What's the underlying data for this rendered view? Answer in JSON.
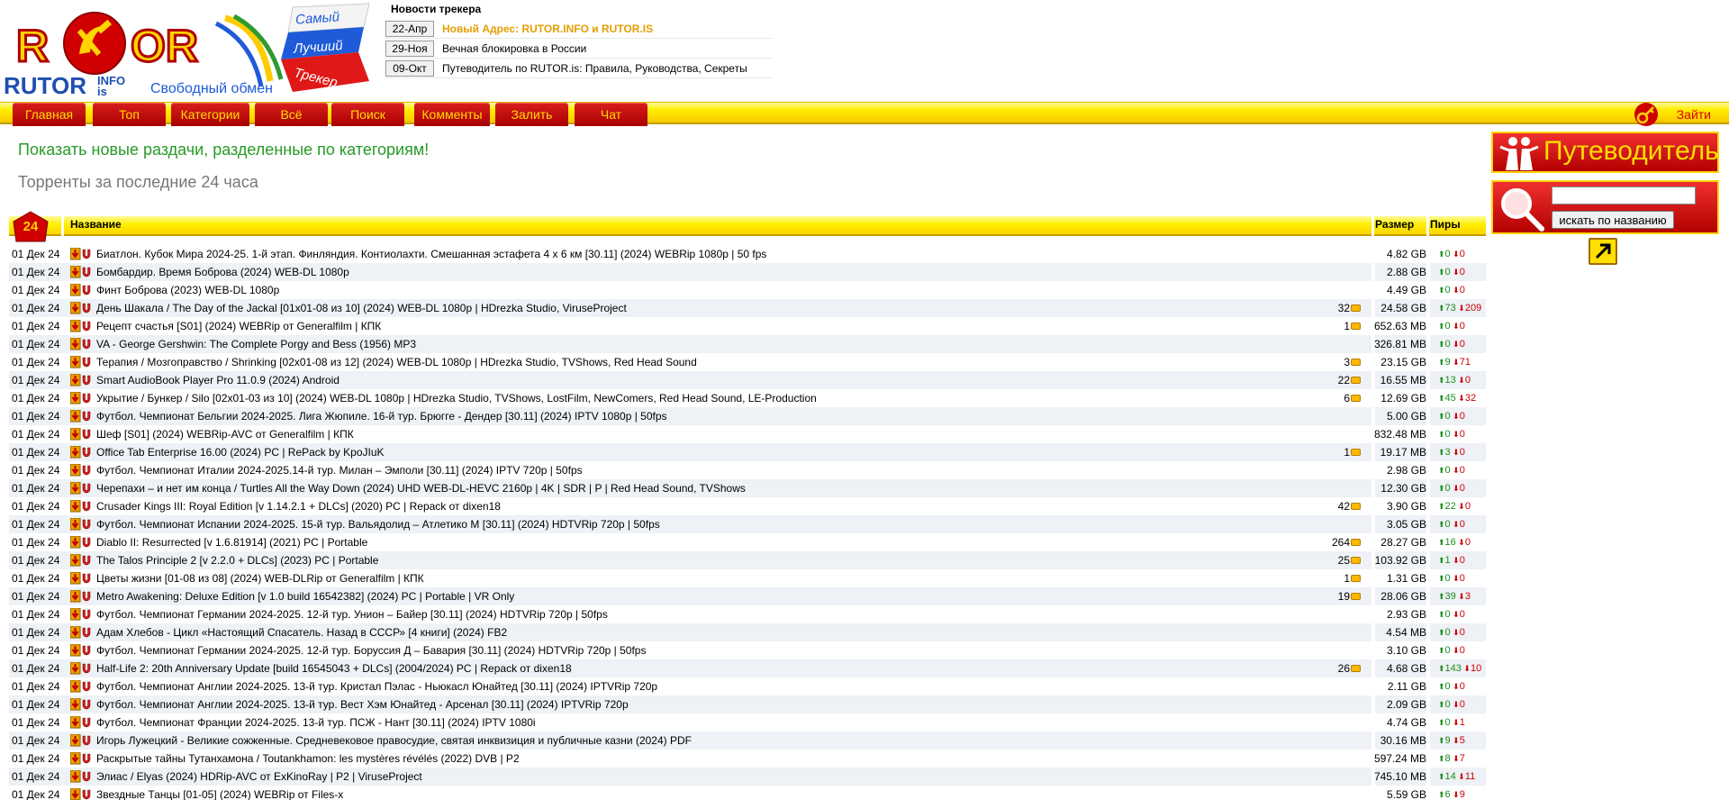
{
  "logo": {
    "tagline_1": "Самый",
    "tagline_2": "Лучший",
    "tagline_3": "Трекер",
    "brand": "RUTOR",
    "brand_info": "INFO",
    "brand_is": "is",
    "slogan": "Свободный обмен"
  },
  "news": {
    "title": "Новости трекера",
    "items": [
      {
        "date": "22-Апр",
        "text": "Новый Адрес: RUTOR.INFO и RUTOR.IS",
        "highlight": true
      },
      {
        "date": "29-Ноя",
        "text": "Вечная блокировка в России",
        "highlight": false
      },
      {
        "date": "09-Окт",
        "text": "Путеводитель по RUTOR.is: Правила, Руководства, Секреты",
        "highlight": false
      }
    ]
  },
  "menu": {
    "items": [
      "Главная",
      "Топ",
      "Категории",
      "Всё",
      "Поиск",
      "Комменты",
      "Залить",
      "Чат"
    ],
    "login": "Зайти"
  },
  "main": {
    "heading": "Показать новые раздачи, разделенные по категориям!",
    "subheading": "Торренты за последние 24 часа",
    "badge": "24",
    "columns": {
      "name": "Название",
      "size": "Размер",
      "peers": "Пиры"
    }
  },
  "torrents": [
    {
      "date": "01 Дек 24",
      "name": "Биатлон. Кубок Мира 2024-25. 1-й этап. Финляндия. Контиолахти. Смешанная эстафета 4 x 6 км [30.11] (2024) WEBRip 1080p | 50 fps",
      "comments": "",
      "size": "4.82 GB",
      "seeds": "0",
      "leech": "0"
    },
    {
      "date": "01 Дек 24",
      "name": "Бомбардир. Время Боброва (2024) WEB-DL 1080p",
      "comments": "",
      "size": "2.88 GB",
      "seeds": "0",
      "leech": "0"
    },
    {
      "date": "01 Дек 24",
      "name": "Финт Боброва (2023) WEB-DL 1080p",
      "comments": "",
      "size": "4.49 GB",
      "seeds": "0",
      "leech": "0"
    },
    {
      "date": "01 Дек 24",
      "name": "День Шакала / The Day of the Jackal [01x01-08 из 10] (2024) WEB-DL 1080p | HDrezka Studio, ViruseProject",
      "comments": "32",
      "size": "24.58 GB",
      "seeds": "73",
      "leech": "209"
    },
    {
      "date": "01 Дек 24",
      "name": "Рецепт счастья [S01] (2024) WEBRip от Generalfilm | КПК",
      "comments": "1",
      "size": "652.63 MB",
      "seeds": "0",
      "leech": "0"
    },
    {
      "date": "01 Дек 24",
      "name": "VA - George Gershwin: The Complete Porgy and Bess (1956) MP3",
      "comments": "",
      "size": "326.81 MB",
      "seeds": "0",
      "leech": "0"
    },
    {
      "date": "01 Дек 24",
      "name": "Терапия / Мозгоправство / Shrinking [02x01-08 из 12] (2024) WEB-DL 1080p | HDrezka Studio, TVShows, Red Head Sound",
      "comments": "3",
      "size": "23.15 GB",
      "seeds": "9",
      "leech": "71"
    },
    {
      "date": "01 Дек 24",
      "name": "Smart AudioBook Player Pro 11.0.9 (2024) Android",
      "comments": "22",
      "size": "16.55 MB",
      "seeds": "13",
      "leech": "0"
    },
    {
      "date": "01 Дек 24",
      "name": "Укрытие / Бункер / Silo [02x01-03 из 10] (2024) WEB-DL 1080p | HDrezka Studio, TVShows, LostFilm, NewComers, Red Head Sound, LE-Production",
      "comments": "6",
      "size": "12.69 GB",
      "seeds": "45",
      "leech": "32"
    },
    {
      "date": "01 Дек 24",
      "name": "Футбол. Чемпионат Бельгии 2024-2025. Лига Жюпиле. 16-й тур. Брюгге - Дендер [30.11] (2024) IPTV 1080p | 50fps",
      "comments": "",
      "size": "5.00 GB",
      "seeds": "0",
      "leech": "0"
    },
    {
      "date": "01 Дек 24",
      "name": "Шеф [S01] (2024) WEBRip-AVC от Generalfilm | КПК",
      "comments": "",
      "size": "832.48 MB",
      "seeds": "0",
      "leech": "0"
    },
    {
      "date": "01 Дек 24",
      "name": "Office Tab Enterprise 16.00 (2024) PC | RePack by KpoJIuK",
      "comments": "1",
      "size": "19.17 MB",
      "seeds": "3",
      "leech": "0"
    },
    {
      "date": "01 Дек 24",
      "name": "Футбол. Чемпионат Италии 2024-2025.14-й тур. Милан – Эмполи [30.11] (2024) IPTV 720p | 50fps",
      "comments": "",
      "size": "2.98 GB",
      "seeds": "0",
      "leech": "0"
    },
    {
      "date": "01 Дек 24",
      "name": "Черепахи – и нет им конца / Turtles All the Way Down (2024) UHD WEB-DL-HEVC 2160p | 4K | SDR | P | Red Head Sound, TVShows",
      "comments": "",
      "size": "12.30 GB",
      "seeds": "0",
      "leech": "0"
    },
    {
      "date": "01 Дек 24",
      "name": "Crusader Kings III: Royal Edition [v 1.14.2.1 + DLCs] (2020) PC | Repack от dixen18",
      "comments": "42",
      "size": "3.90 GB",
      "seeds": "22",
      "leech": "0"
    },
    {
      "date": "01 Дек 24",
      "name": "Футбол. Чемпионат Испании 2024-2025. 15-й тур. Вальядолид – Атлетико М [30.11] (2024) HDTVRip 720p | 50fps",
      "comments": "",
      "size": "3.05 GB",
      "seeds": "0",
      "leech": "0"
    },
    {
      "date": "01 Дек 24",
      "name": "Diablo II: Resurrected [v 1.6.81914] (2021) PC | Portable",
      "comments": "264",
      "size": "28.27 GB",
      "seeds": "16",
      "leech": "0"
    },
    {
      "date": "01 Дек 24",
      "name": "The Talos Principle 2 [v 2.2.0 + DLCs] (2023) PC | Portable",
      "comments": "25",
      "size": "103.92 GB",
      "seeds": "1",
      "leech": "0"
    },
    {
      "date": "01 Дек 24",
      "name": "Цветы жизни [01-08 из 08] (2024) WEB-DLRip от Generalfilm | КПК",
      "comments": "1",
      "size": "1.31 GB",
      "seeds": "0",
      "leech": "0"
    },
    {
      "date": "01 Дек 24",
      "name": "Metro Awakening: Deluxe Edition [v 1.0 build 16542382] (2024) PC | Portable | VR Only",
      "comments": "19",
      "size": "28.06 GB",
      "seeds": "39",
      "leech": "3"
    },
    {
      "date": "01 Дек 24",
      "name": "Футбол. Чемпионат Германии 2024-2025. 12-й тур. Унион – Байер [30.11] (2024) HDTVRip 720p | 50fps",
      "comments": "",
      "size": "2.93 GB",
      "seeds": "0",
      "leech": "0"
    },
    {
      "date": "01 Дек 24",
      "name": "Адам Хлебов - Цикл «Настоящий Спасатель. Назад в СССР» [4 книги] (2024) FB2",
      "comments": "",
      "size": "4.54 MB",
      "seeds": "0",
      "leech": "0"
    },
    {
      "date": "01 Дек 24",
      "name": "Футбол. Чемпионат Германии 2024-2025. 12-й тур. Боруссия Д – Бавария [30.11] (2024) HDTVRip 720p | 50fps",
      "comments": "",
      "size": "3.10 GB",
      "seeds": "0",
      "leech": "0"
    },
    {
      "date": "01 Дек 24",
      "name": "Half-Life 2: 20th Anniversary Update [build 16545043 + DLCs] (2004/2024) PC | Repack от dixen18",
      "comments": "26",
      "size": "4.68 GB",
      "seeds": "143",
      "leech": "10"
    },
    {
      "date": "01 Дек 24",
      "name": "Футбол. Чемпионат Англии 2024-2025. 13-й тур. Кристал Пэлас - Ньюкасл Юнайтед [30.11] (2024) IPTVRip 720p",
      "comments": "",
      "size": "2.11 GB",
      "seeds": "0",
      "leech": "0"
    },
    {
      "date": "01 Дек 24",
      "name": "Футбол. Чемпионат Англии 2024-2025. 13-й тур. Вест Хэм Юнайтед - Арсенал [30.11] (2024) IPTVRip 720p",
      "comments": "",
      "size": "2.09 GB",
      "seeds": "0",
      "leech": "0"
    },
    {
      "date": "01 Дек 24",
      "name": "Футбол. Чемпионат Франции 2024-2025. 13-й тур. ПСЖ - Нант [30.11] (2024) IPTV 1080i",
      "comments": "",
      "size": "4.74 GB",
      "seeds": "0",
      "leech": "1"
    },
    {
      "date": "01 Дек 24",
      "name": "Игорь Лужецкий - Великие сожженные. Средневековое правосудие, святая инквизиция и публичные казни (2024) PDF",
      "comments": "",
      "size": "30.16 MB",
      "seeds": "9",
      "leech": "5"
    },
    {
      "date": "01 Дек 24",
      "name": "Раскрытые тайны Тутанхамона / Toutankhamon: les mystères révélés (2022) DVB | P2",
      "comments": "",
      "size": "597.24 MB",
      "seeds": "8",
      "leech": "7"
    },
    {
      "date": "01 Дек 24",
      "name": "Элиас / Elyas (2024) HDRip-AVC от ExKinoRay | P2 | ViruseProject",
      "comments": "",
      "size": "745.10 MB",
      "seeds": "14",
      "leech": "11"
    },
    {
      "date": "01 Дек 24",
      "name": "Звездные Танцы [01-05] (2024) WEBRip от Files-x",
      "comments": "",
      "size": "5.59 GB",
      "seeds": "6",
      "leech": "9"
    }
  ],
  "sidebar": {
    "guide": "Путеводитель",
    "search_value": "",
    "search_button": "искать по названию"
  },
  "colors": {
    "menu_red": "#c00000",
    "menu_text": "#ffdc00",
    "yellow_bar": "#ffef00",
    "heading_green": "#289a28",
    "news_highlight": "#e49f00",
    "seed_green": "#1c8c1c",
    "leech_red": "#cc0000"
  }
}
